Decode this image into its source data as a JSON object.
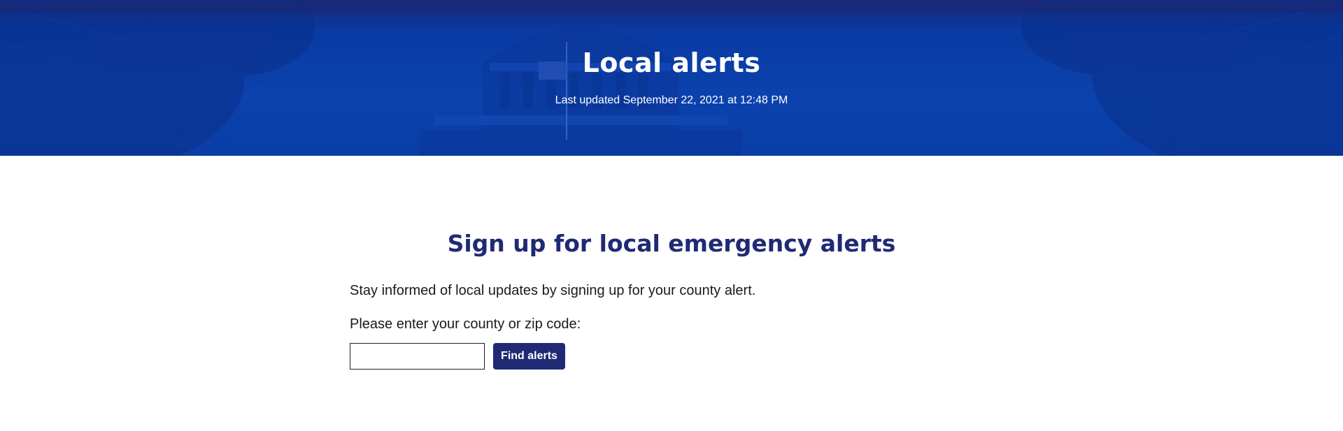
{
  "hero": {
    "title": "Local alerts",
    "last_updated": "Last updated September 22, 2021 at 12:48 PM",
    "background_image": "capitol-dome-and-trees"
  },
  "signup": {
    "heading": "Sign up for local emergency alerts",
    "intro": "Stay informed of local updates by signing up for your county alert.",
    "prompt": "Please enter your county or zip code:",
    "input_value": "",
    "input_placeholder": "",
    "button_label": "Find alerts"
  },
  "colors": {
    "hero_blue": "#0b42ad",
    "navy": "#202a74",
    "text": "#1a1a1a",
    "white": "#ffffff"
  }
}
